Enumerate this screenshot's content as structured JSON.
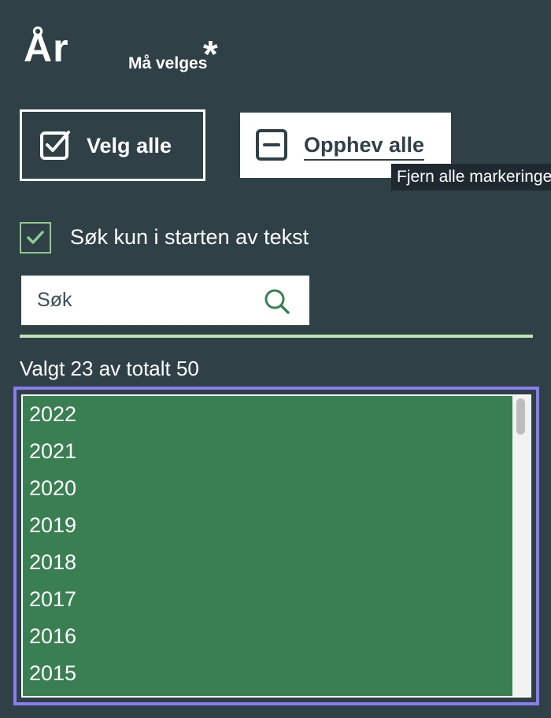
{
  "header": {
    "title": "År",
    "required_label": "Må velges",
    "asterisk": "*"
  },
  "buttons": {
    "select_all": "Velg alle",
    "deselect_all": "Opphev alle"
  },
  "tooltip": {
    "text": "Fjern alle markeringer"
  },
  "filter": {
    "checkbox_checked": true,
    "checkbox_label": "Søk kun i starten av tekst"
  },
  "search": {
    "placeholder": "Søk",
    "value": ""
  },
  "selection": {
    "status_text": "Valgt 23 av totalt 50"
  },
  "list": {
    "items": [
      "2022",
      "2021",
      "2020",
      "2019",
      "2018",
      "2017",
      "2016",
      "2015"
    ]
  },
  "colors": {
    "background": "#2f4047",
    "selected_item": "#3a7f52",
    "accent_green": "#bfe3b7",
    "focus_outline": "#8a7cf0",
    "search_icon": "#3a7f52"
  },
  "icons": {
    "select_all": "checkbox-checked-icon",
    "deselect_all": "checkbox-minus-icon",
    "checkbox": "checkmark-icon",
    "search": "search-icon"
  }
}
